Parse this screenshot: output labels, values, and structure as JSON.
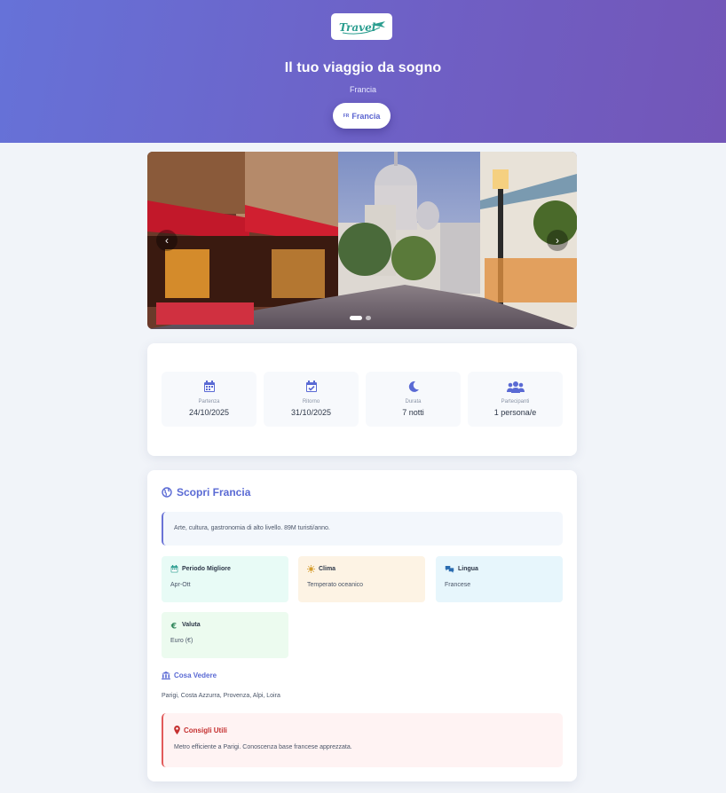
{
  "header": {
    "logo_text": "Travel",
    "title": "Il tuo viaggio da sogno",
    "subtitle": "Francia",
    "country_pill": {
      "code": "FR",
      "label": "Francia"
    }
  },
  "carousel": {
    "prev_label": "‹",
    "next_label": "›",
    "slide_count": 2,
    "active_slide": 1
  },
  "trip": {
    "items": [
      {
        "icon": "calendar-icon",
        "label": "Partenza",
        "value": "24/10/2025"
      },
      {
        "icon": "calendar-check-icon",
        "label": "Ritorno",
        "value": "31/10/2025"
      },
      {
        "icon": "moon-icon",
        "label": "Durata",
        "value": "7 notti"
      },
      {
        "icon": "users-icon",
        "label": "Partecipanti",
        "value": "1 persona/e"
      }
    ]
  },
  "discover": {
    "title": "Scopri Francia",
    "description": "Arte, cultura, gastronomia di alto livello. 89M turisti/anno.",
    "features": [
      {
        "icon": "calendar-icon",
        "title": "Periodo Migliore",
        "value": "Apr-Ott"
      },
      {
        "icon": "sun-icon",
        "title": "Clima",
        "value": "Temperato oceanico"
      },
      {
        "icon": "chat-icon",
        "title": "Lingua",
        "value": "Francese"
      },
      {
        "icon": "euro-icon",
        "title": "Valuta",
        "value": "Euro (€)"
      }
    ],
    "see_title": "Cosa Vedere",
    "see_text": "Parigi, Costa Azzurra, Provenza, Alpi, Loira",
    "tips_title": "Consigli Utili",
    "tips_text": "Metro efficiente a Parigi. Conoscenza base francese apprezzata."
  },
  "colors": {
    "accent": "#5a6ad4",
    "hero_start": "#6672d8",
    "hero_end": "#7356b8",
    "tips_red": "#c53030"
  }
}
